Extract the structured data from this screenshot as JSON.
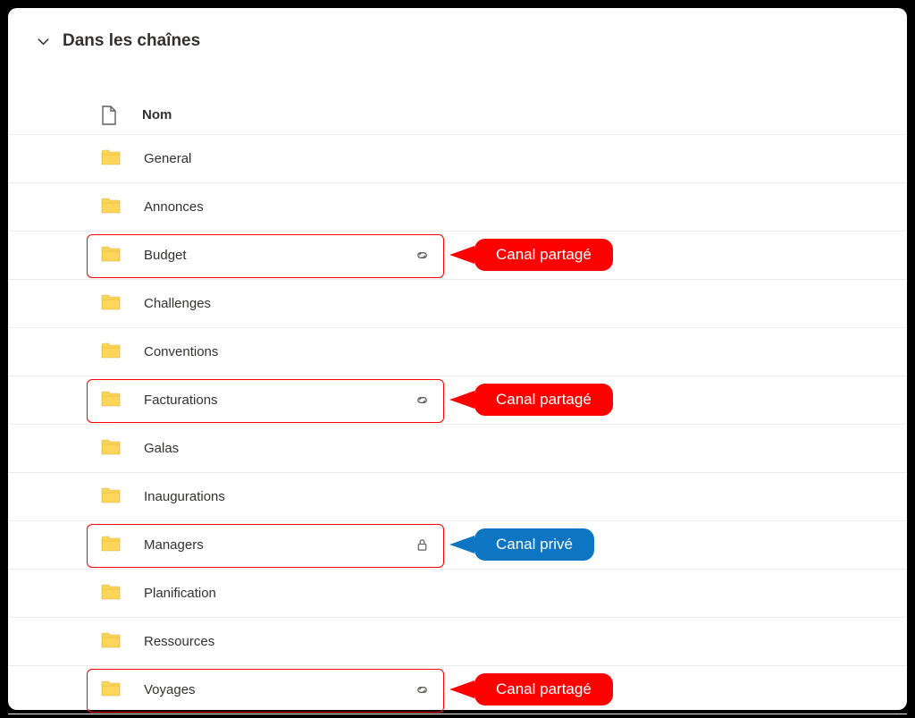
{
  "section_title": "Dans les chaînes",
  "header": {
    "name_label": "Nom"
  },
  "rows": [
    {
      "name": "General",
      "status": null
    },
    {
      "name": "Annonces",
      "status": null
    },
    {
      "name": "Budget",
      "status": "shared"
    },
    {
      "name": "Challenges",
      "status": null
    },
    {
      "name": "Conventions",
      "status": null
    },
    {
      "name": "Facturations",
      "status": "shared"
    },
    {
      "name": "Galas",
      "status": null
    },
    {
      "name": "Inaugurations",
      "status": null
    },
    {
      "name": "Managers",
      "status": "private"
    },
    {
      "name": "Planification",
      "status": null
    },
    {
      "name": "Ressources",
      "status": null
    },
    {
      "name": "Voyages",
      "status": "shared"
    }
  ],
  "callouts": {
    "shared": "Canal partagé",
    "private": "Canal privé"
  }
}
